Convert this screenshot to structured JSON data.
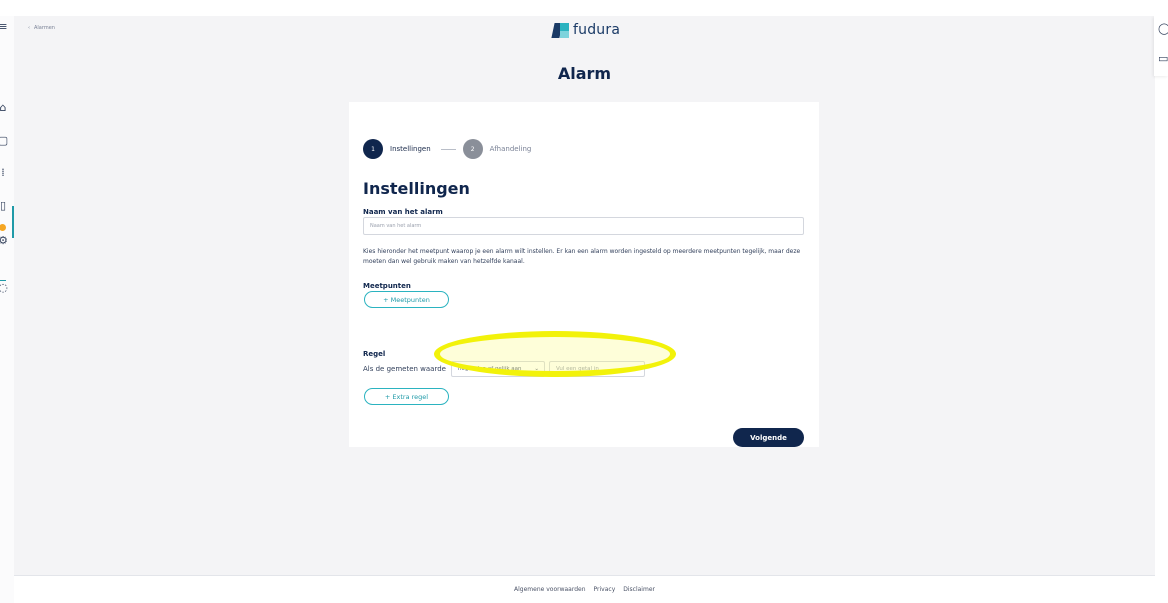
{
  "header": {
    "breadcrumb": "Alarmen",
    "brand": "fudura"
  },
  "page": {
    "title": "Alarm"
  },
  "stepper": {
    "steps": [
      {
        "number": "1",
        "label": "Instellingen",
        "state": "active"
      },
      {
        "number": "2",
        "label": "Afhandeling",
        "state": "inactive"
      }
    ]
  },
  "form": {
    "section_title": "Instellingen",
    "name_label": "Naam van het alarm",
    "name_placeholder": "Naam van het alarm",
    "description": "Kies hieronder het meetpunt waarop je een alarm wilt instellen. Er kan een alarm worden ingesteld op meerdere meetpunten tegelijk, maar deze moeten dan wel gebruik maken van hetzelfde kanaal.",
    "meetpunten_label": "Meetpunten",
    "meetpunten_button": "+ Meetpunten",
    "rule_label": "Regel",
    "rule_text": "Als de gemeten waarde",
    "rule_operator": "hoger dan of gelijk aan",
    "rule_value_placeholder": "Vul een getal in",
    "extra_rule_button": "+ Extra regel",
    "next_button": "Volgende"
  },
  "footer": {
    "links": [
      "Algemene voorwaarden",
      "Privacy",
      "Disclaimer"
    ]
  },
  "sidebar": {
    "icons": [
      "menu-icon",
      "home-icon",
      "document-icon",
      "grid-icon",
      "alarm-icon",
      "settings-icon",
      "help-icon"
    ]
  },
  "colors": {
    "navy": "#10264d",
    "teal": "#2bb3c0",
    "highlight": "#f2f20a",
    "background": "#f4f4f6"
  }
}
